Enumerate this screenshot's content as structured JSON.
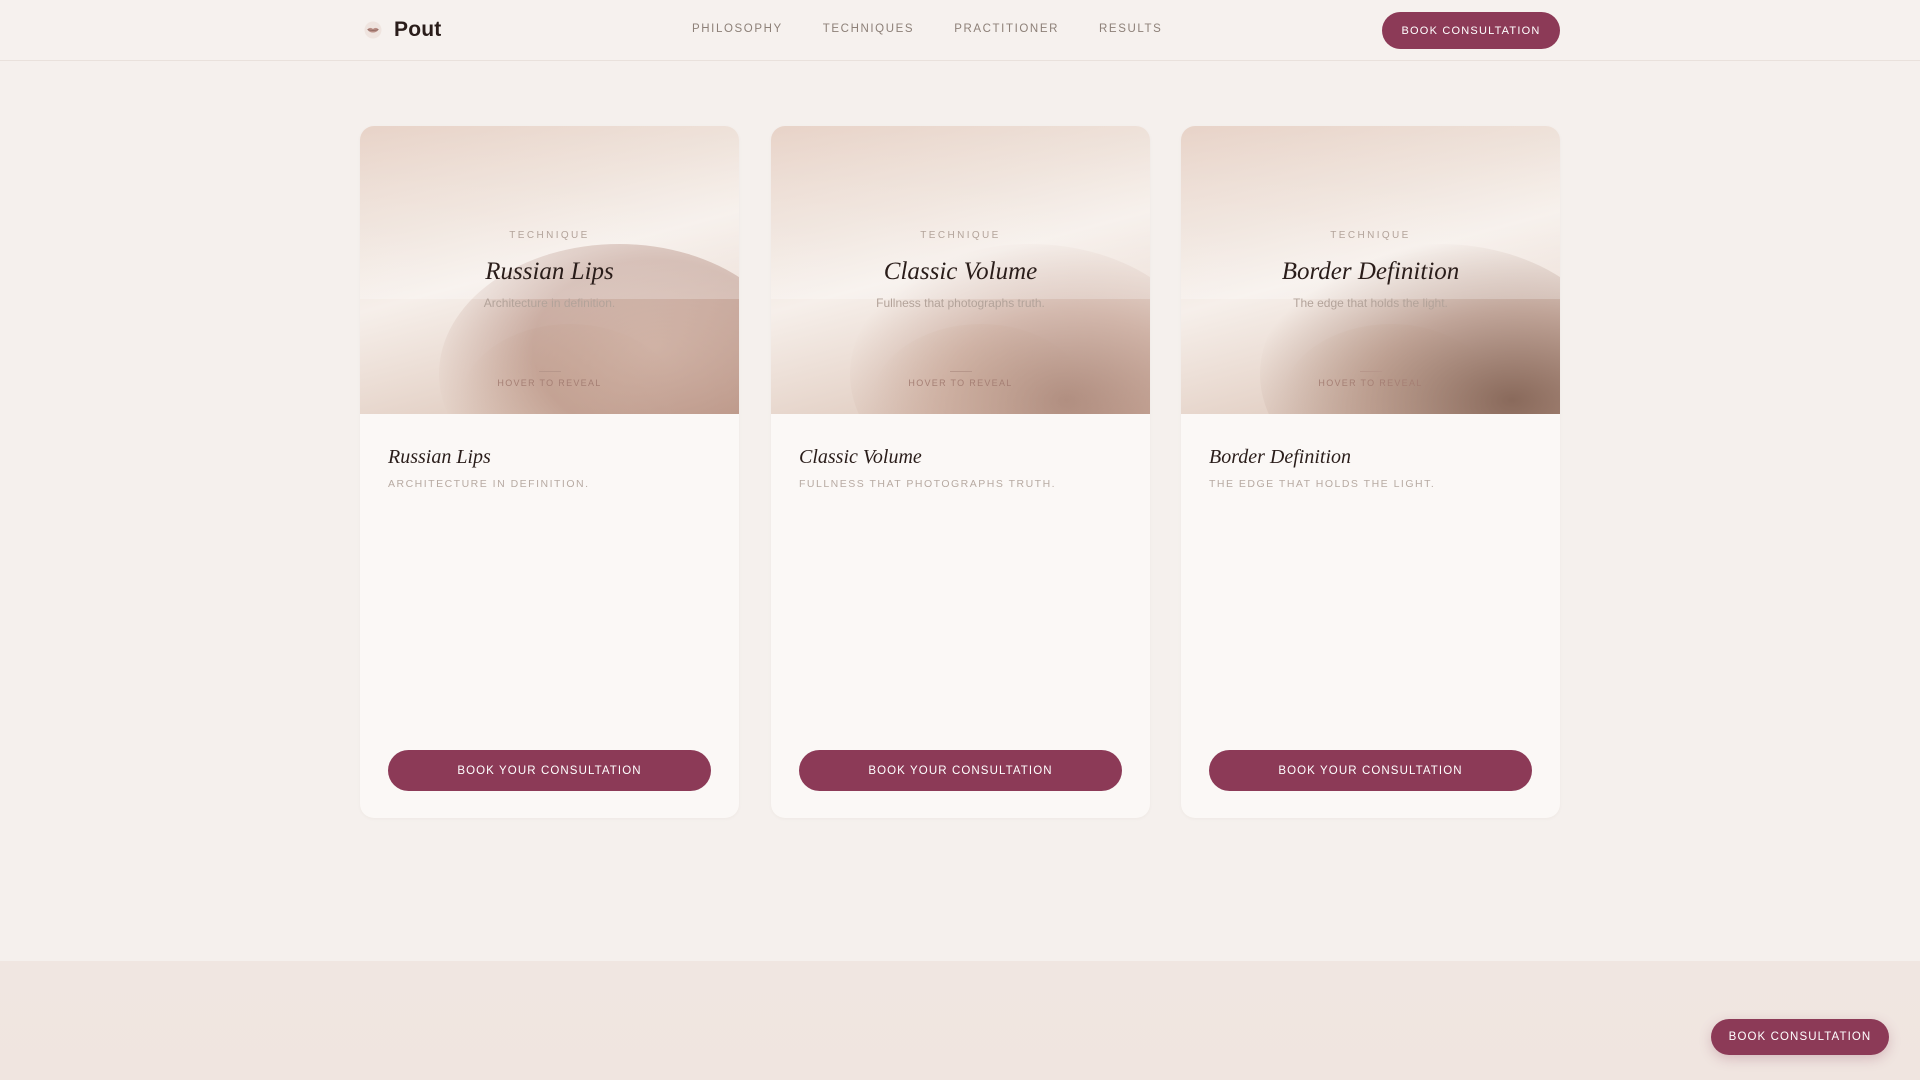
{
  "header": {
    "brand_name": "Pout",
    "brand_icon": "lips-icon",
    "nav": [
      "PHILOSOPHY",
      "TECHNIQUES",
      "PRACTITIONER",
      "RESULTS"
    ],
    "cta_label": "BOOK CONSULTATION"
  },
  "cards": [
    {
      "eyebrow": "TECHNIQUE",
      "title": "Russian Lips",
      "subtitle": "Architecture in definition.",
      "hint": "HOVER TO REVEAL",
      "body_title": "Russian Lips",
      "body_subtitle": "ARCHITECTURE IN DEFINITION.",
      "cta_label": "BOOK YOUR CONSULTATION"
    },
    {
      "eyebrow": "TECHNIQUE",
      "title": "Classic Volume",
      "subtitle": "Fullness that photographs truth.",
      "hint": "HOVER TO REVEAL",
      "body_title": "Classic Volume",
      "body_subtitle": "FULLNESS THAT PHOTOGRAPHS TRUTH.",
      "cta_label": "BOOK YOUR CONSULTATION"
    },
    {
      "eyebrow": "TECHNIQUE",
      "title": "Border Definition",
      "subtitle": "The edge that holds the light.",
      "hint": "HOVER TO REVEAL",
      "body_title": "Border Definition",
      "body_subtitle": "THE EDGE THAT HOLDS THE LIGHT.",
      "cta_label": "BOOK YOUR CONSULTATION"
    }
  ],
  "floating_cta": {
    "label": "BOOK CONSULTATION"
  },
  "colors": {
    "accent": "#8c3a57",
    "background": "#f5f0ed",
    "card": "#fbf8f6",
    "text": "#2a1d1a",
    "muted": "#b3a39a"
  }
}
